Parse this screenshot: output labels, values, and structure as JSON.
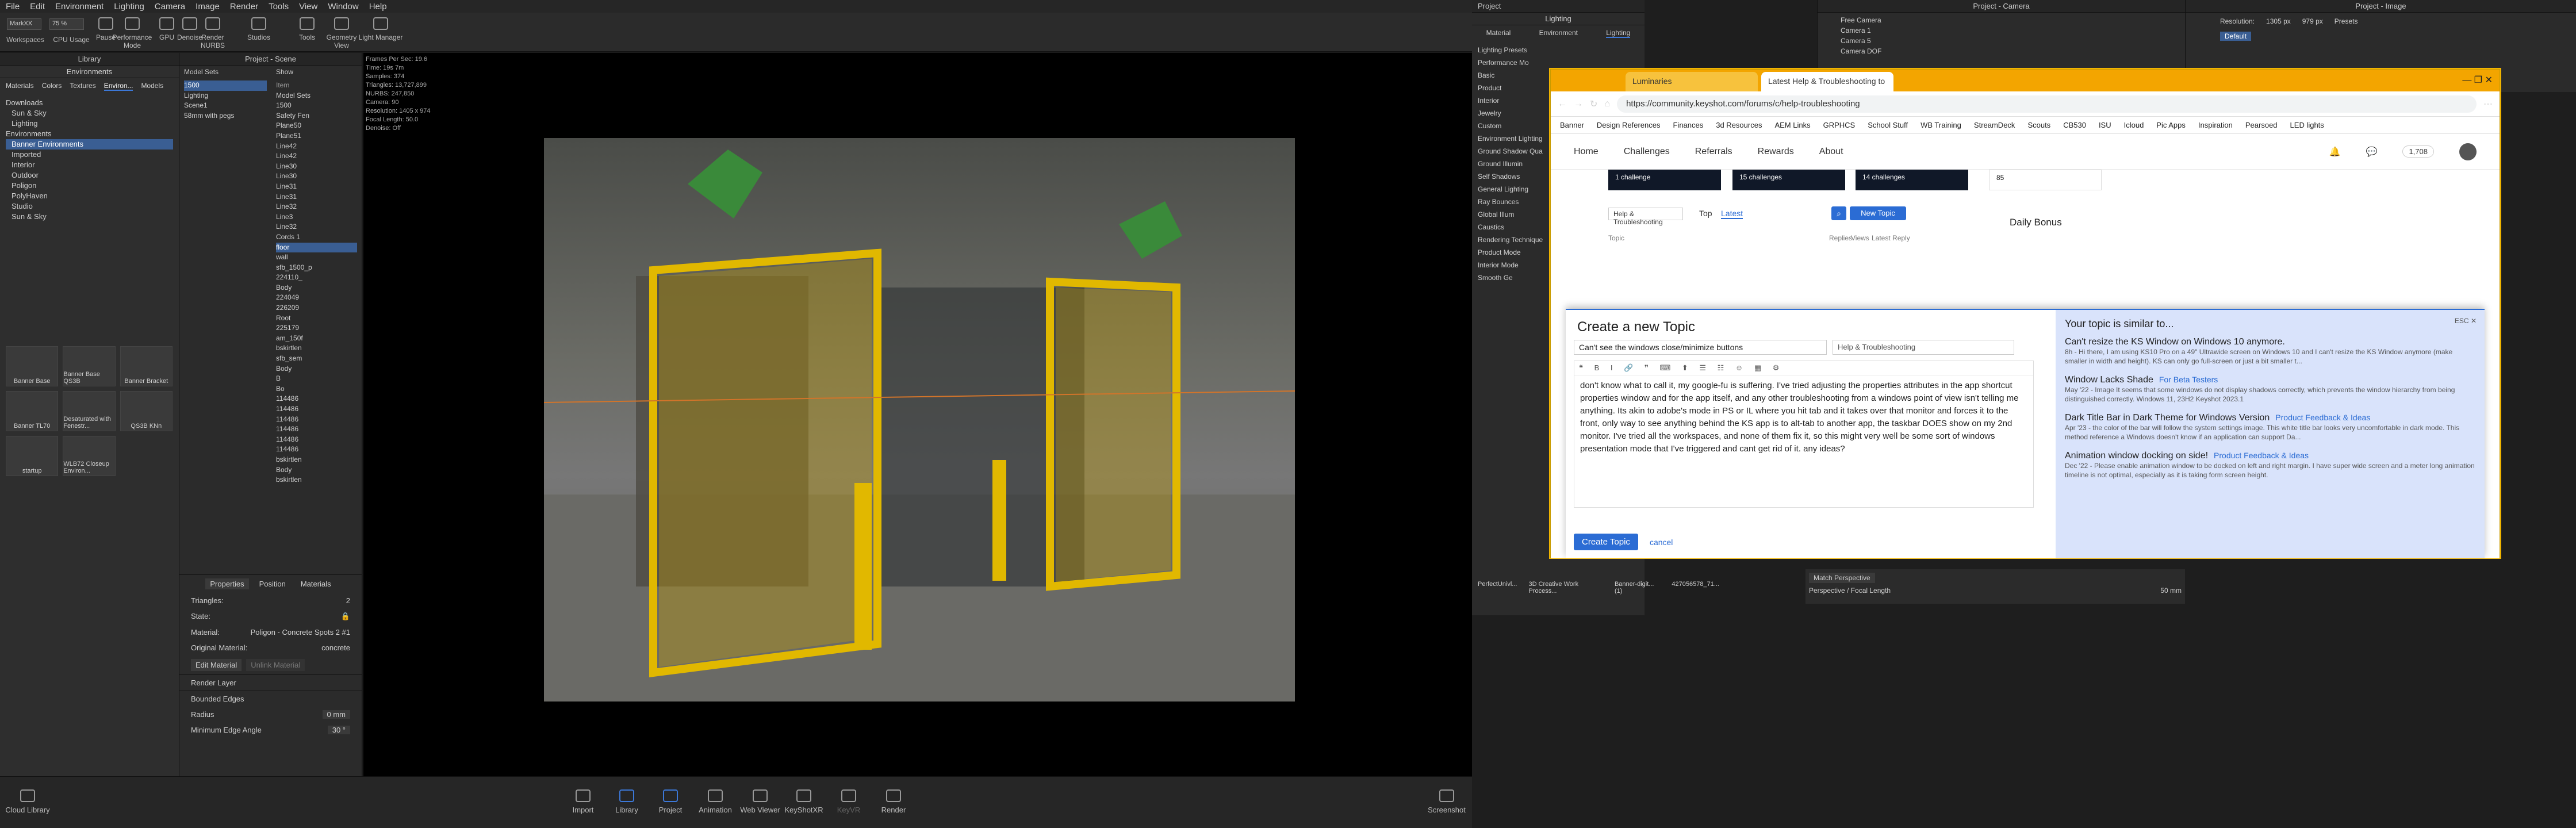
{
  "app": {
    "menu": [
      "File",
      "Edit",
      "Environment",
      "Lighting",
      "Camera",
      "Image",
      "Render",
      "Tools",
      "View",
      "Window",
      "Help"
    ],
    "toolbar": [
      {
        "label": "Workspaces"
      },
      {
        "label": "CPU Usage"
      },
      {
        "label": "Pause"
      },
      {
        "label": "Performance Mode"
      },
      {
        "label": "GPU"
      },
      {
        "label": "Denoise"
      },
      {
        "label": "Render NURBS"
      },
      {
        "label": "Studios"
      },
      {
        "label": "Tools"
      },
      {
        "label": "Geometry View"
      },
      {
        "label": "Light Manager"
      }
    ],
    "workspace_value": "MarkXX",
    "zoom_value": "75 %",
    "library": {
      "title": "Library",
      "subtitle": "Environments",
      "tabs": [
        "Materials",
        "Colors",
        "Textures",
        "Environ...",
        "Models"
      ],
      "tree": [
        "Downloads",
        "Sun & Sky",
        "Lighting",
        "Environments",
        "Banner Environments",
        "Imported",
        "Interior",
        "Outdoor",
        "Poligon",
        "PolyHaven",
        "Studio",
        "Sun & Sky"
      ],
      "thumbs": [
        "Banner Base",
        "Banner Base QS3B",
        "Banner Bracket",
        "Banner TL70",
        "Desaturated with Fenestr...",
        "QS3B KNn",
        "startup",
        "WLB72 Closeup Environ..."
      ]
    },
    "scene": {
      "title": "Project - Scene",
      "model_sets_label": "Model Sets",
      "show_label": "Show",
      "stats": [
        {
          "k": "Frames Per Sec:",
          "v": "19.6"
        },
        {
          "k": "Time:",
          "v": "19s 7m"
        },
        {
          "k": "Samples:",
          "v": "374"
        },
        {
          "k": "Triangles:",
          "v": "13,727,899"
        },
        {
          "k": "NURBS:",
          "v": "247,850"
        },
        {
          "k": "Camera:",
          "v": "90"
        },
        {
          "k": "Resolution:",
          "v": "1405 x 974"
        },
        {
          "k": "Focal Length:",
          "v": "50.0"
        },
        {
          "k": "Denoise:",
          "v": "Off"
        }
      ],
      "model_sets": [
        "1500",
        "Lighting",
        "Scene1",
        "58mm with pegs"
      ],
      "items": [
        "Model Sets",
        "1500",
        "Safety Fen",
        "Plane50",
        "Plane51",
        "Line42",
        "Line42",
        "Line30",
        "Line30",
        "Line31",
        "Line31",
        "Line32",
        "Line3",
        "Line32",
        "Cords 1",
        "floor",
        "wall",
        "sfb_1500_p",
        "224110_",
        "Body",
        "224049",
        "226209",
        "Root",
        "225179",
        "am_150f",
        "bskirtlen",
        "sfb_sem",
        "Body",
        "B",
        "Bo",
        "114486",
        "114486",
        "114486",
        "114486",
        "114486",
        "114486",
        "bskirtlen",
        "Body",
        "bskirtlen"
      ],
      "item_header": "Item"
    },
    "properties": {
      "tabs": [
        "Properties",
        "Position",
        "Materials"
      ],
      "triangles_label": "Triangles:",
      "triangles": "2",
      "state_label": "State:",
      "material_label": "Material:",
      "material": "Poligon - Concrete Spots 2 #1",
      "original_label": "Original Material:",
      "original": "concrete",
      "edit_btn": "Edit Material",
      "unlink_btn": "Unlink Material",
      "render_layer": "Render Layer",
      "bounded_edges": "Bounded Edges",
      "radius_label": "Radius",
      "radius": "0 mm",
      "min_edge_label": "Minimum Edge Angle",
      "min_edge": "30 °"
    },
    "bottom": [
      {
        "label": "Cloud Library"
      },
      {
        "label": "Import"
      },
      {
        "label": "Library"
      },
      {
        "label": "Project"
      },
      {
        "label": "Animation"
      },
      {
        "label": "Web Viewer"
      },
      {
        "label": "KeyShotXR"
      },
      {
        "label": "KeyVR"
      },
      {
        "label": "Render"
      },
      {
        "label": "Screenshot"
      }
    ]
  },
  "right_panels": {
    "project": "Project",
    "lighting_title": "Lighting",
    "lighting_tabs": [
      "Material",
      "Environment",
      "Lighting"
    ],
    "lighting_presets": "Lighting Presets",
    "preset_options": [
      "Performance Mo",
      "Basic",
      "Product",
      "Interior",
      "Jewelry",
      "Custom"
    ],
    "env_lighting": "Environment Lighting",
    "ground_shadow": "Ground Shadow Qua",
    "ground_illum": "Ground Illumin",
    "self_shadows": "Self Shadows",
    "general_lighting": "General Lighting",
    "ray_bounces": "Ray Bounces",
    "global_illum": "Global Illum",
    "caustics": "Caustics",
    "rendering_technique": "Rendering Technique",
    "product_mode": "Product Mode",
    "interior_mode": "Interior Mode",
    "smooth": "Smooth Ge",
    "camera_title": "Project - Camera",
    "cameras": [
      "Free Camera",
      "Camera 1",
      "Camera 5",
      "Camera DOF"
    ],
    "image_title": "Project - Image",
    "resolution_label": "Resolution:",
    "res_w": "1305 px",
    "res_h": "979 px",
    "presets": "Presets",
    "default_label": "Default",
    "match_perspective": "Match Perspective",
    "persp_focal": "Perspective / Focal Length",
    "focal_value": "50 mm",
    "taskbar_items": [
      "PerfectUnivl...",
      "3D Creative Work Process...",
      "Banner-digit... (1)",
      "427056578_71..."
    ]
  },
  "browser": {
    "tab1": "Luminaries",
    "tab2": "Latest Help & Troubleshooting to",
    "url": "https://community.keyshot.com/forums/c/help-troubleshooting",
    "bookmarks": [
      "Banner",
      "Design References",
      "Finances",
      "3d Resources",
      "AEM Links",
      "GRPHCS",
      "School Stuff",
      "WB Training",
      "StreamDeck",
      "Scouts",
      "CB530",
      "ISU",
      "Icloud",
      "Pic Apps",
      "Inspiration",
      "Pearsoed",
      "LED lights"
    ],
    "nav": [
      "Home",
      "Challenges",
      "Referrals",
      "Rewards",
      "About"
    ],
    "points": "1,708",
    "cards": [
      "1 challenge",
      "15 challenges",
      "14 challenges",
      "85"
    ],
    "category": "Help & Troubleshooting",
    "top_tab": "Top",
    "latest_tab": "Latest",
    "new_topic": "New Topic",
    "table_topic": "Topic",
    "table_replies": "Replies",
    "table_views": "Views",
    "table_latest": "Latest Reply",
    "daily_bonus": "Daily Bonus",
    "composer": {
      "heading": "Create a new Topic",
      "title_value": "Can't see the windows close/minimize buttons",
      "category": "Help & Troubleshooting",
      "body": "don't know what to call it, my google-fu is suffering. I've tried adjusting the properties attributes in the app shortcut properties window and for the app itself, and any other troubleshooting from a windows point of view isn't telling me anything. Its akin to adobe's mode in PS or IL where you hit tab and it takes over that monitor and forces it to the front, only way to see anything behind the KS app is to alt-tab to another app, the taskbar DOES show on my 2nd monitor. I've tried all the workspaces, and none of them fix it, so this might very well be some sort of windows presentation mode that I've triggered and cant get rid of it. any ideas?",
      "create_btn": "Create Topic",
      "cancel": "cancel"
    },
    "similar": {
      "title": "Your topic is similar to...",
      "esc": "ESC",
      "items": [
        {
          "title": "Can't resize the KS Window on Windows 10 anymore.",
          "category": "",
          "excerpt": "8h - Hi there, I am using KS10 Pro on a 49\" Ultrawide screen on Windows 10 and I can't resize the KS Window anymore (make smaller in width and height). KS can only go full-screen or just a bit smaller t..."
        },
        {
          "title": "Window Lacks Shade",
          "category": "For Beta Testers",
          "excerpt": "May '22 - Image It seems that some windows do not display shadows correctly, which prevents the window hierarchy from being distinguished correctly. Windows 11, 23H2 Keyshot 2023.1"
        },
        {
          "title": "Dark Title Bar in Dark Theme for Windows Version",
          "category": "Product Feedback & Ideas",
          "excerpt": "Apr '23 - the color of the bar will follow the system settings image. This white title bar looks very uncomfortable in dark mode. This method reference a Windows doesn't know if an application can support Da..."
        },
        {
          "title": "Animation window docking on side!",
          "category": "Product Feedback & Ideas",
          "excerpt": "Dec '22 - Please enable animation window to be docked on left and right margin. I have super wide screen and a meter long animation timeline is not optimal, especially as it is taking form screen height."
        }
      ]
    }
  }
}
